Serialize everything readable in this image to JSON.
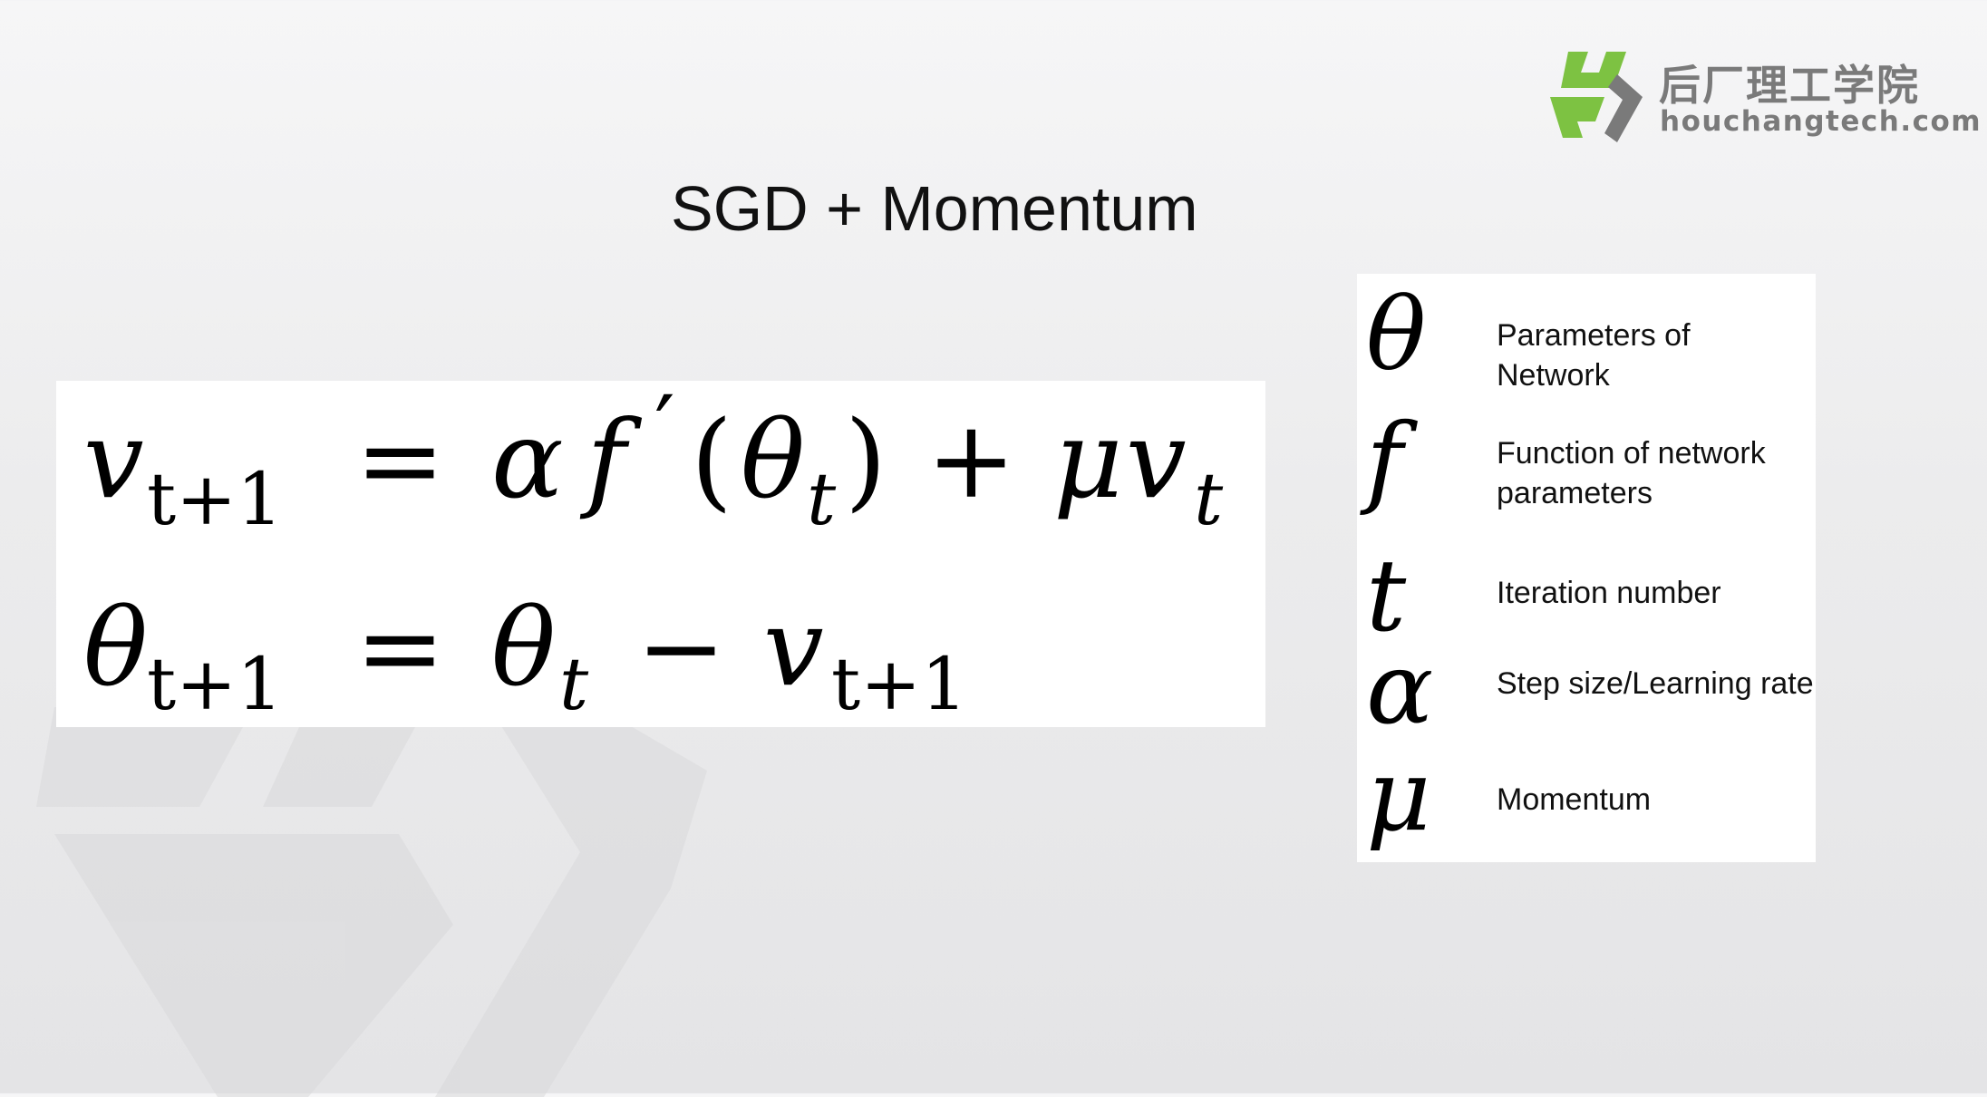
{
  "logo": {
    "name_cn": "后厂理工学院",
    "url": "houchangtech.com",
    "colors": {
      "green": "#7dc242",
      "gray": "#7a7a7a"
    }
  },
  "slide": {
    "title": "SGD + Momentum"
  },
  "equations": {
    "line1": {
      "lhs_var": "v",
      "lhs_sub": "t+1",
      "eq": "=",
      "alpha": "α",
      "f": "f",
      "prime": "′",
      "lparen": "(",
      "theta": "θ",
      "theta_sub": "t",
      "rparen": ")",
      "plus": "+",
      "mu": "μ",
      "v": "v",
      "v_sub": "t"
    },
    "line2": {
      "lhs_var": "θ",
      "lhs_sub": "t+1",
      "eq": "=",
      "theta": "θ",
      "theta_sub": "t",
      "minus": "−",
      "v": "v",
      "v_sub": "t+1"
    }
  },
  "legend": {
    "items": [
      {
        "symbol": "θ",
        "line1": "Parameters of",
        "line2": "Network"
      },
      {
        "symbol": "f",
        "line1": "Function of network",
        "line2": "parameters"
      },
      {
        "symbol": "t",
        "line1": "Iteration number",
        "line2": ""
      },
      {
        "symbol": "α",
        "line1": "Step size/Learning rate",
        "line2": ""
      },
      {
        "symbol": "μ",
        "line1": "Momentum",
        "line2": ""
      }
    ]
  }
}
